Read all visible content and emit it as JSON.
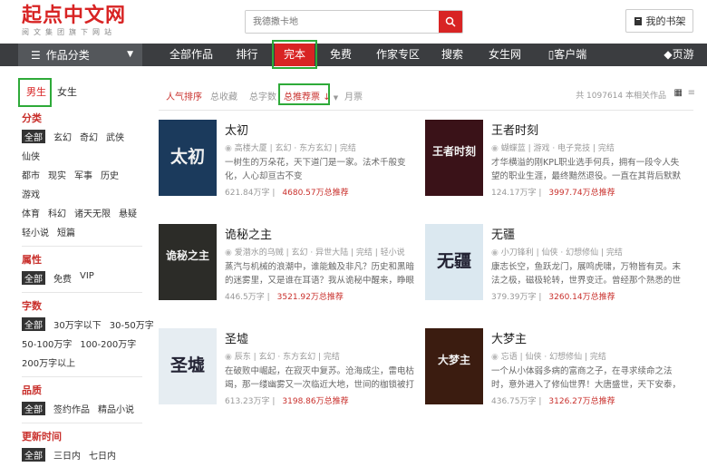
{
  "header": {
    "logo_text": "起点中文网",
    "logo_sub": "阅文集团旗下网站",
    "search_placeholder": "我德撒卡地",
    "shelf_label": "我的书架"
  },
  "nav": {
    "category_label": "作品分类",
    "items": [
      "全部作品",
      "排行",
      "完本",
      "免费",
      "作家专区",
      "搜索",
      "女生网",
      "客户端",
      "页游"
    ]
  },
  "sidebar": {
    "tabs": [
      "男生",
      "女生"
    ],
    "sections": [
      {
        "title": "分类",
        "rows": [
          [
            "全部",
            "玄幻",
            "奇幻",
            "武侠"
          ],
          [
            "仙侠"
          ],
          [
            "都市",
            "现实",
            "军事",
            "历史"
          ],
          [
            "游戏"
          ],
          [
            "体育",
            "科幻",
            "诸天无限",
            "悬疑"
          ],
          [
            "轻小说",
            "短篇"
          ]
        ]
      },
      {
        "title": "属性",
        "rows": [
          [
            "全部",
            "免费",
            "VIP"
          ]
        ]
      },
      {
        "title": "字数",
        "rows": [
          [
            "全部",
            "30万字以下",
            "30-50万字"
          ],
          [
            "50-100万字",
            "100-200万字"
          ],
          [
            "200万字以上"
          ]
        ]
      },
      {
        "title": "品质",
        "rows": [
          [
            "全部",
            "签约作品",
            "精品小说"
          ]
        ]
      },
      {
        "title": "更新时间",
        "rows": [
          [
            "全部",
            "三日内",
            "七日内"
          ]
        ]
      }
    ]
  },
  "sortbar": {
    "items": [
      "人气排序",
      "总收藏",
      "总字数",
      "总推荐票",
      "月票"
    ],
    "total": "共 1097614 本相关作品"
  },
  "books": [
    {
      "title": "太初",
      "author": "高楼大厦",
      "tags": "玄幻 · 东方玄幻",
      "status": "完结",
      "intro": "一树生的万朵花，天下道门是一家。法术千般变化，人心却亘古不变",
      "words": "621.84万字",
      "recommend": "4680.57万总推荐",
      "cover_text": "太初",
      "cover_color": "#1b3a5c"
    },
    {
      "title": "王者时刻",
      "author": "蝴蝶蓝",
      "tags": "游戏 · 电子竞技",
      "status": "完结",
      "intro": "才华横溢的刚KPL职业选手何兵，拥有一段令人失望的职业生涯，最终黯然退役。一直在其背后默默支持着他的",
      "words": "124.17万字",
      "recommend": "3997.74万总推荐",
      "cover_text": "王者时刻",
      "cover_color": "#3a1218"
    },
    {
      "title": "诡秘之主",
      "author": "爱潜水的乌贼",
      "tags": "玄幻 · 异世大陆",
      "status": "完结",
      "extra": "轻小说",
      "intro": "蒸汽与机械的浪潮中，谁能触及非凡？历史和黑暗的迷雾里，又是谁在耳语？我从诡秘中醒来，睁眼看见这个",
      "words": "446.5万字",
      "recommend": "3521.92万总推荐",
      "cover_text": "诡秘之主",
      "cover_color": "#2c2c28"
    },
    {
      "title": "无疆",
      "author": "小刀锋利",
      "tags": "仙侠 · 幻想修仙",
      "status": "完结",
      "intro": "康志长空，鱼跃龙门，展鸣虎啸，万物皆有灵。末法之极，磁极轮转，世界变迁。曾经那个熟悉的世界，已经",
      "words": "379.39万字",
      "recommend": "3260.14万总推荐",
      "cover_text": "无疆",
      "cover_color": "#dbe8f0"
    },
    {
      "title": "圣墟",
      "author": "辰东",
      "tags": "玄幻 · 东方玄幻",
      "status": "完结",
      "intro": "在破败中崛起，在寂灭中复苏。沧海成尘，雷电枯竭，那一缕幽雾又一次临近大地，世间的枷锁被打开了，一",
      "words": "613.23万字",
      "recommend": "3198.86万总推荐",
      "cover_text": "圣墟",
      "cover_color": "#e6edf2"
    },
    {
      "title": "大梦主",
      "author": "忘语",
      "tags": "仙侠 · 幻想修仙",
      "status": "完结",
      "intro": "一个从小体弱多病的富商之子，在寻求续命之法时，意外进入了修仙世界！大唐盛世，天下安泰，风调雨",
      "words": "436.75万字",
      "recommend": "3126.27万总推荐",
      "cover_text": "大梦主",
      "cover_color": "#3b1c10"
    }
  ]
}
